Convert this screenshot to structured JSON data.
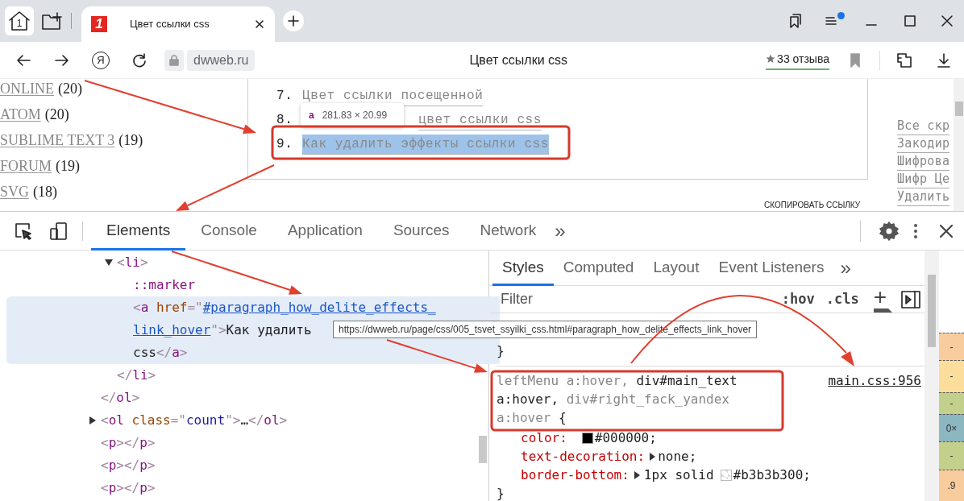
{
  "browser": {
    "home_badge": "1",
    "tabs": [
      {
        "favicon": "1",
        "title": "Цвет ссылки css",
        "selected": true
      }
    ],
    "menu_notification": true,
    "address_bar": {
      "yandex": "Я",
      "domain": "dwweb.ru",
      "page_title": "Цвет ссылки css",
      "reviews": "33 отзыва"
    }
  },
  "page": {
    "left_links": [
      {
        "label": "ONLINE",
        "count": "(20)"
      },
      {
        "label": "ATOM",
        "count": "(20)"
      },
      {
        "label": "SUBLIME TEXT 3",
        "count": "(19)"
      },
      {
        "label": "FORUM",
        "count": "(19)"
      },
      {
        "label": "SVG",
        "count": "(18)"
      }
    ],
    "list_items": [
      {
        "kind": "plain",
        "number": "7.",
        "text": "Цвет ссылки посещенной",
        "selected": false
      },
      {
        "kind": "covered",
        "number": "8.",
        "text": "цвет ссылки css",
        "selected": false
      },
      {
        "kind": "plain",
        "number": "9.",
        "text": "Как удалить эффекты ссылки css",
        "selected": true
      }
    ],
    "element_tooltip": {
      "tag": "a",
      "size": "281.83 × 20.99"
    },
    "right_links": [
      "Все скр",
      "Закодир",
      "Шифрова",
      "Шифр Це",
      "Удалить"
    ],
    "copy_link": "СКОПИРОВАТЬ ССЫЛКУ"
  },
  "devtools": {
    "tabs": [
      {
        "label": "Elements",
        "selected": true
      },
      {
        "label": "Console",
        "selected": false
      },
      {
        "label": "Application",
        "selected": false
      },
      {
        "label": "Sources",
        "selected": false
      },
      {
        "label": "Network",
        "selected": false
      }
    ],
    "more_tabs": "»",
    "dom_tree": [
      {
        "close": [
          {
            "text": "</",
            "kind": "p"
          },
          {
            "text": "ol",
            "kind": "t"
          },
          {
            "text": ">",
            "kind": "p"
          }
        ],
        "children": [
          {
            "expanded": true,
            "open": [
              {
                "text": "<",
                "kind": "p"
              },
              {
                "text": "li",
                "kind": "t"
              },
              {
                "text": ">",
                "kind": "p"
              }
            ],
            "close": [
              {
                "text": "</",
                "kind": "p"
              },
              {
                "text": "li",
                "kind": "t"
              },
              {
                "text": ">",
                "kind": "p"
              }
            ],
            "children": [
              {
                "open": [
                  {
                    "text": "::marker",
                    "kind": "s"
                  }
                ]
              },
              {
                "selected": true,
                "open": [
                  {
                    "text": "<",
                    "kind": "p"
                  },
                  {
                    "text": "a",
                    "kind": "t"
                  },
                  {
                    "text": " href",
                    "kind": "a"
                  },
                  {
                    "text": "=\"",
                    "kind": "p"
                  },
                  {
                    "text": "#paragraph_how_delite_effects_",
                    "kind": "l"
                  }
                ],
                "wrap": [
                  [
                    {
                      "text": "link_hover",
                      "kind": "l"
                    },
                    {
                      "text": "\">",
                      "kind": "p"
                    },
                    {
                      "text": "Как удалить",
                      "kind": "x"
                    }
                  ],
                  [
                    {
                      "text": "css",
                      "kind": "x"
                    },
                    {
                      "text": "</",
                      "kind": "p"
                    },
                    {
                      "text": "a",
                      "kind": "t"
                    },
                    {
                      "text": ">",
                      "kind": "p"
                    }
                  ]
                ]
              }
            ]
          }
        ]
      },
      {
        "expanded": false,
        "open": [
          {
            "text": "<",
            "kind": "p"
          },
          {
            "text": "ol",
            "kind": "t"
          },
          {
            "text": " class",
            "kind": "a"
          },
          {
            "text": "=\"",
            "kind": "p"
          },
          {
            "text": "count",
            "kind": "v"
          },
          {
            "text": "\">",
            "kind": "p"
          },
          {
            "text": "…",
            "kind": "x"
          },
          {
            "text": "</",
            "kind": "p"
          },
          {
            "text": "ol",
            "kind": "t"
          },
          {
            "text": ">",
            "kind": "p"
          }
        ]
      },
      {
        "open": [
          {
            "text": "<",
            "kind": "p"
          },
          {
            "text": "p",
            "kind": "t"
          },
          {
            "text": "></",
            "kind": "p"
          },
          {
            "text": "p",
            "kind": "t"
          },
          {
            "text": ">",
            "kind": "p"
          }
        ]
      },
      {
        "open": [
          {
            "text": "<",
            "kind": "p"
          },
          {
            "text": "p",
            "kind": "t"
          },
          {
            "text": "></",
            "kind": "p"
          },
          {
            "text": "p",
            "kind": "t"
          },
          {
            "text": ">",
            "kind": "p"
          }
        ]
      },
      {
        "open": [
          {
            "text": "<",
            "kind": "p"
          },
          {
            "text": "p",
            "kind": "t"
          },
          {
            "text": "></",
            "kind": "p"
          },
          {
            "text": "p",
            "kind": "t"
          },
          {
            "text": ">",
            "kind": "p"
          }
        ]
      }
    ],
    "url_tooltip": "https://dwweb.ru/page/css/005_tsvet_ssyilki_css.html#paragraph_how_delite_effects_link_hover",
    "sidebar_tabs": [
      {
        "label": "Styles",
        "selected": true
      },
      {
        "label": "Computed",
        "selected": false
      },
      {
        "label": "Layout",
        "selected": false
      },
      {
        "label": "Event Listeners",
        "selected": false
      }
    ],
    "more_sidebar_tabs": "»",
    "filter": {
      "placeholder": "Filter",
      "hov": ":hov",
      "cls": ".cls",
      "add": "+"
    },
    "prev_rule_end": "}",
    "rule": {
      "selector_lines": [
        [
          {
            "text": "leftMenu a:hover,",
            "kind": "dim"
          },
          {
            "text": " div#main_text",
            "kind": "match"
          }
        ],
        [
          {
            "text": "a:hover,",
            "kind": "match"
          },
          {
            "text": " div#right_fack_yandex",
            "kind": "dim"
          }
        ],
        [
          {
            "text": "a:hover",
            "kind": "dim"
          },
          {
            "text": " {",
            "kind": "match"
          }
        ]
      ],
      "source": "main.css:956",
      "declarations": [
        {
          "name": "color:",
          "swatch": {
            "kind": "solid",
            "color": "#000000"
          },
          "value": "#000000;"
        },
        {
          "name": "text-decoration:",
          "expandable": true,
          "value": "none;"
        },
        {
          "name": "border-bottom:",
          "expandable": true,
          "prefix": "1px solid",
          "swatch": {
            "kind": "checker"
          },
          "value": "#b3b3b300;"
        }
      ],
      "end": "}"
    },
    "box_model": [
      {
        "color": "#f9cc9d",
        "text": "-"
      },
      {
        "color": "#fddd9b",
        "text": "-"
      },
      {
        "color": "#c3d08b",
        "text": "-"
      },
      {
        "color": "#8cb6c0",
        "text": "0×"
      },
      {
        "color": "#c3d08b",
        "text": "-"
      },
      {
        "color": "#f9cc9d",
        "text": ".9"
      }
    ]
  }
}
